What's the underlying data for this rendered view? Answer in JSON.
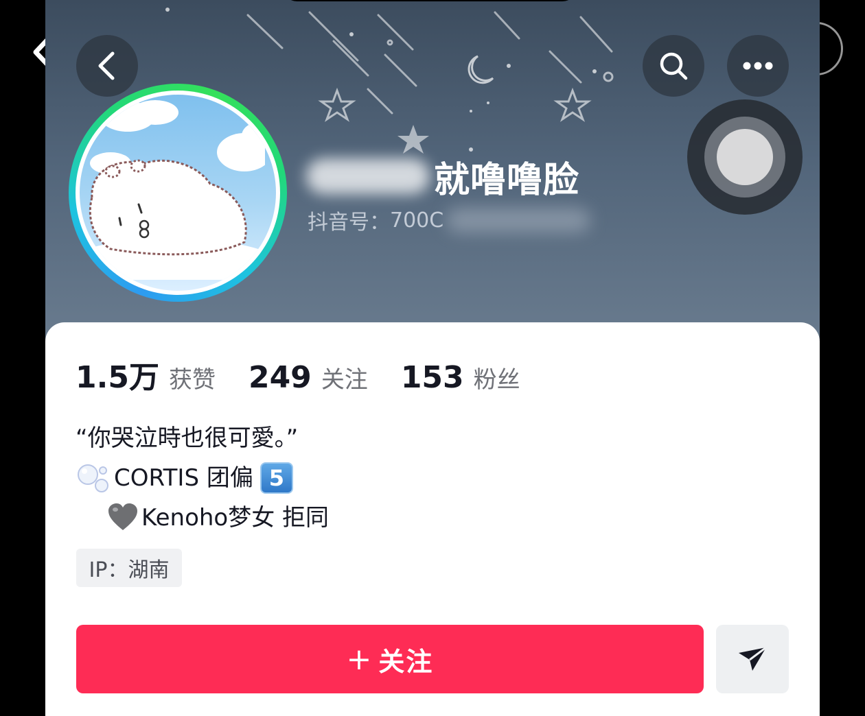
{
  "profile": {
    "username_visible": "就噜噜脸",
    "douyin_id_label": "抖音号：",
    "douyin_id_visible": "700C"
  },
  "header": {
    "back_icon": "chevron-left-icon",
    "search_icon": "search-icon",
    "more_icon": "more-dots-icon"
  },
  "stats": [
    {
      "value": "1.5万",
      "label": "获赞"
    },
    {
      "value": "249",
      "label": "关注"
    },
    {
      "value": "153",
      "label": "粉丝"
    }
  ],
  "bio": {
    "line1": "“你哭泣時也很可愛。”",
    "line2_text": "CORTIS 团偏",
    "line2_keycap": "5",
    "line3_text": "Kenoho梦女 拒同"
  },
  "ip_tag": "IP：湖南",
  "actions": {
    "follow_plus": "+",
    "follow_label": "关注",
    "share_icon": "send-icon"
  },
  "colors": {
    "follow_button": "#fe2c55",
    "banner_top": "#3c4c5e",
    "text_primary": "#161823",
    "text_secondary": "#6f7177"
  }
}
